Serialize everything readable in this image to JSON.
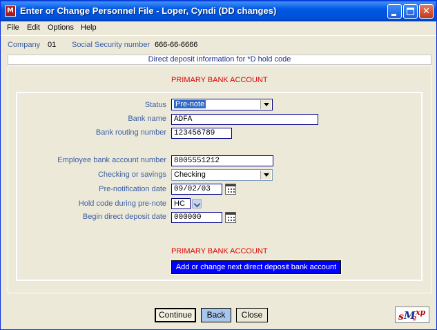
{
  "window": {
    "title": "Enter or Change Personnel File - Loper, Cyndi  (DD changes)",
    "app_icon_text": "M"
  },
  "menu": [
    "File",
    "Edit",
    "Options",
    "Help"
  ],
  "info": {
    "company_label": "Company",
    "company_value": "01",
    "ssn_label": "Social Security number",
    "ssn_value": "666-66-6666"
  },
  "strip_text": "Direct deposit information for  *D  hold code",
  "section_title": "PRIMARY BANK ACCOUNT",
  "form": {
    "status_label": "Status",
    "status_value": "Pre-note",
    "bank_name_label": "Bank name",
    "bank_name_value": "ADFA",
    "routing_label": "Bank routing number",
    "routing_value": " 123456789",
    "acct_label": "Employee bank account number",
    "acct_value": "8005551212",
    "checking_label": "Checking or savings",
    "checking_value": "Checking",
    "prenote_label": "Pre-notification date",
    "prenote_value": " 09/02/03",
    "hold_label": "Hold code during pre-note",
    "hold_value": "HC",
    "begin_label": "Begin direct deposit date",
    "begin_value": "  000000"
  },
  "bottom_title": "PRIMARY BANK ACCOUNT",
  "add_button": "Add or change next direct deposit bank account",
  "buttons": {
    "continue": "Continue",
    "back": "Back",
    "close": "Close"
  },
  "logo_text": "sM2xp",
  "colors": {
    "titlebar": "#0058e6",
    "label_blue": "#3b5ea6",
    "heading_red": "#e00000",
    "add_button": "#0000ff"
  }
}
